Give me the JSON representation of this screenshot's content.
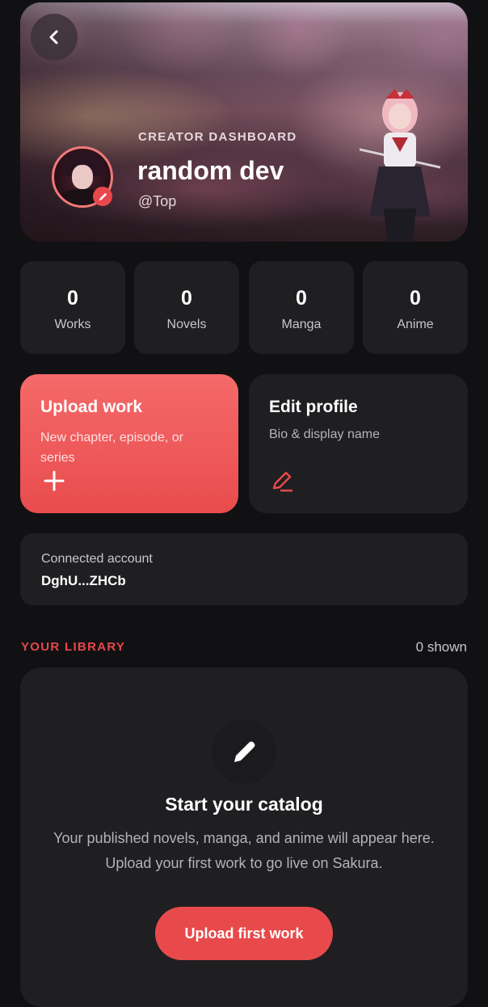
{
  "hero": {
    "eyebrow": "CREATOR DASHBOARD",
    "name": "random dev",
    "handle": "@Top",
    "icons": {
      "back": "chevron-left-icon",
      "avatar_edit": "pencil-icon"
    },
    "colors": {
      "accent": "#e8484c",
      "avatar_ring": "#f07a7a"
    }
  },
  "stats": [
    {
      "value": "0",
      "label": "Works"
    },
    {
      "value": "0",
      "label": "Novels"
    },
    {
      "value": "0",
      "label": "Manga"
    },
    {
      "value": "0",
      "label": "Anime"
    }
  ],
  "actions": {
    "upload": {
      "title": "Upload work",
      "subtitle": "New chapter, episode, or series",
      "icon": "plus-icon"
    },
    "edit": {
      "title": "Edit profile",
      "subtitle": "Bio & display name",
      "icon": "pen-icon"
    }
  },
  "account": {
    "label": "Connected account",
    "value": "DghU...ZHCb"
  },
  "library": {
    "title": "YOUR LIBRARY",
    "count": "0 shown",
    "empty": {
      "icon": "pencil-icon",
      "title": "Start your catalog",
      "body": "Your published novels, manga, and anime will appear here. Upload your first work to go live on Sakura.",
      "button": "Upload first work"
    }
  },
  "colors": {
    "background": "#111113",
    "card": "#1f1f22",
    "accent": "#e8484c",
    "accent_light": "#f56a6a"
  }
}
